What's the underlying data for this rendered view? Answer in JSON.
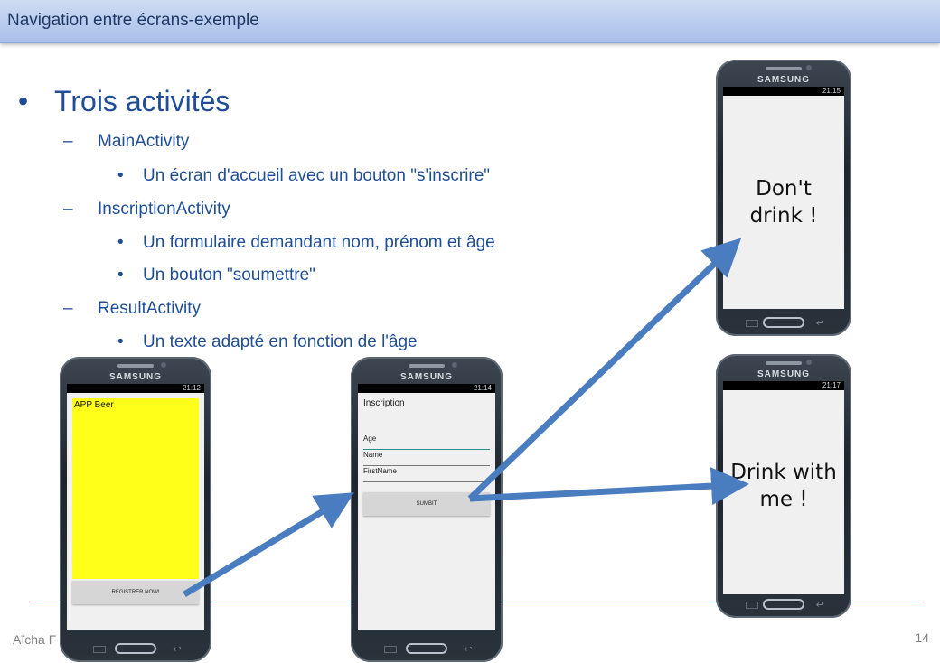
{
  "slide": {
    "title": "Navigation entre écrans-exemple",
    "heading_bullet": "•",
    "heading": "Trois activités",
    "items": [
      {
        "marker": "–",
        "text": "MainActivity"
      },
      {
        "marker": "•",
        "text": "Un écran d'accueil avec un bouton \"s'inscrire\""
      },
      {
        "marker": "–",
        "text": "InscriptionActivity"
      },
      {
        "marker": "•",
        "text": "Un formulaire demandant nom, prénom et âge"
      },
      {
        "marker": "•",
        "text": "Un bouton \"soumettre\""
      },
      {
        "marker": "–",
        "text": "ResultActivity"
      },
      {
        "marker": "•",
        "text": "Un texte adapté en fonction de l'âge"
      }
    ],
    "footer_author": "Aïcha F",
    "page_number": "14"
  },
  "phones": {
    "brand": "SAMSUNG",
    "main": {
      "time": "21:12",
      "app_label": "APP Beer",
      "button_label": "REGISTRER NOW!",
      "screen_color": "#ffff1a"
    },
    "inscription": {
      "time": "21:14",
      "title": "Inscription",
      "fields": [
        "Age",
        "Name",
        "FirstName"
      ],
      "button_label": "SUMBIT"
    },
    "result_top": {
      "time": "21:15",
      "message_line1": "Don't",
      "message_line2": "drink !"
    },
    "result_bottom": {
      "time": "21:17",
      "message_line1": "Drink with",
      "message_line2": "me !"
    }
  },
  "colors": {
    "title_text": "#1f3866",
    "body_text": "#1f4e96",
    "arrow": "#4a7cc0",
    "footer_line": "#6fa6b0"
  }
}
